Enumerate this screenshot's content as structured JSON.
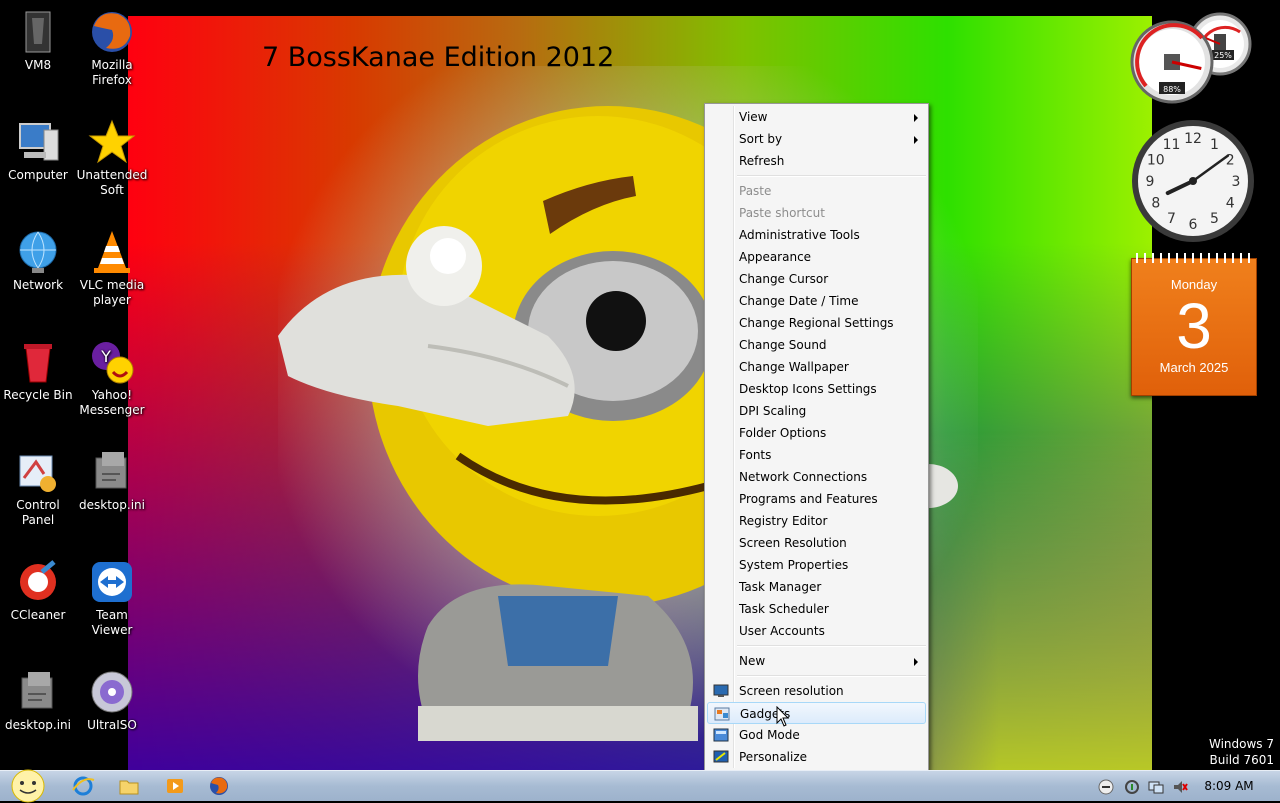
{
  "wallpaper": {
    "title": "7 BossKanae Edition 2012"
  },
  "desktop_icons": [
    {
      "id": "vm8",
      "label": "VM8",
      "icon": "vm8-icon"
    },
    {
      "id": "firefox",
      "label": "Mozilla Firefox",
      "icon": "firefox-icon"
    },
    {
      "id": "computer",
      "label": "Computer",
      "icon": "computer-icon"
    },
    {
      "id": "unattended",
      "label": "Unattended Soft",
      "icon": "star-icon"
    },
    {
      "id": "network",
      "label": "Network",
      "icon": "network-globe-icon"
    },
    {
      "id": "vlc",
      "label": "VLC media player",
      "icon": "vlc-cone-icon"
    },
    {
      "id": "recycle",
      "label": "Recycle Bin",
      "icon": "recycle-bin-icon"
    },
    {
      "id": "yahoo",
      "label": "Yahoo! Messenger",
      "icon": "yahoo-messenger-icon"
    },
    {
      "id": "control",
      "label": "Control Panel",
      "icon": "control-panel-icon"
    },
    {
      "id": "desktopini1",
      "label": "desktop.ini",
      "icon": "config-file-icon"
    },
    {
      "id": "ccleaner",
      "label": "CCleaner",
      "icon": "ccleaner-icon"
    },
    {
      "id": "teamviewer",
      "label": "Team Viewer",
      "icon": "teamviewer-icon"
    },
    {
      "id": "desktopini2",
      "label": "desktop.ini",
      "icon": "config-file-icon"
    },
    {
      "id": "ultraiso",
      "label": "UltraISO",
      "icon": "disc-icon"
    }
  ],
  "gadgets": {
    "cpu_meter": {
      "cpu": "88%",
      "memory": "25%",
      "cpu_fraction": 0.88,
      "memory_fraction": 0.25
    },
    "clock": {
      "hour": 8,
      "minute": 9
    },
    "calendar": {
      "day_of_week": "Monday",
      "day": "3",
      "month_year": "March 2025"
    }
  },
  "context_menu": {
    "groups": [
      [
        {
          "label": "View",
          "submenu": true
        },
        {
          "label": "Sort by",
          "submenu": true
        },
        {
          "label": "Refresh"
        }
      ],
      [
        {
          "label": "Paste",
          "disabled": true
        },
        {
          "label": "Paste shortcut",
          "disabled": true
        },
        {
          "label": "Administrative Tools"
        },
        {
          "label": "Appearance"
        },
        {
          "label": "Change Cursor"
        },
        {
          "label": "Change Date / Time"
        },
        {
          "label": "Change Regional Settings"
        },
        {
          "label": "Change Sound"
        },
        {
          "label": "Change Wallpaper"
        },
        {
          "label": "Desktop Icons Settings"
        },
        {
          "label": "DPI Scaling"
        },
        {
          "label": "Folder Options"
        },
        {
          "label": "Fonts"
        },
        {
          "label": "Network Connections"
        },
        {
          "label": "Programs and Features"
        },
        {
          "label": "Registry Editor"
        },
        {
          "label": "Screen Resolution"
        },
        {
          "label": "System Properties"
        },
        {
          "label": "Task Manager"
        },
        {
          "label": "Task Scheduler"
        },
        {
          "label": "User Accounts"
        }
      ],
      [
        {
          "label": "New",
          "submenu": true
        }
      ],
      [
        {
          "label": "Screen resolution",
          "icon": "monitor-icon"
        },
        {
          "label": "Gadgets",
          "icon": "gadgets-icon",
          "hover": true
        },
        {
          "label": "God Mode",
          "icon": "god-mode-icon"
        },
        {
          "label": "Personalize",
          "icon": "personalize-icon"
        }
      ]
    ]
  },
  "taskbar": {
    "pinned": [
      "start-orb-icon",
      "internet-explorer-icon",
      "explorer-folder-icon",
      "media-player-icon",
      "firefox-icon"
    ],
    "tray": [
      "smiley-tray-icon",
      "action-center-icon",
      "network-tray-icon",
      "volume-muted-icon"
    ],
    "clock": "8:09 AM"
  },
  "watermark": {
    "line1": "Windows 7",
    "line2": "Build 7601"
  },
  "colors": {
    "menu_bg": "#f5f5f5",
    "calendar_orange": "#e8701a",
    "taskbar": "#aabfd6"
  }
}
